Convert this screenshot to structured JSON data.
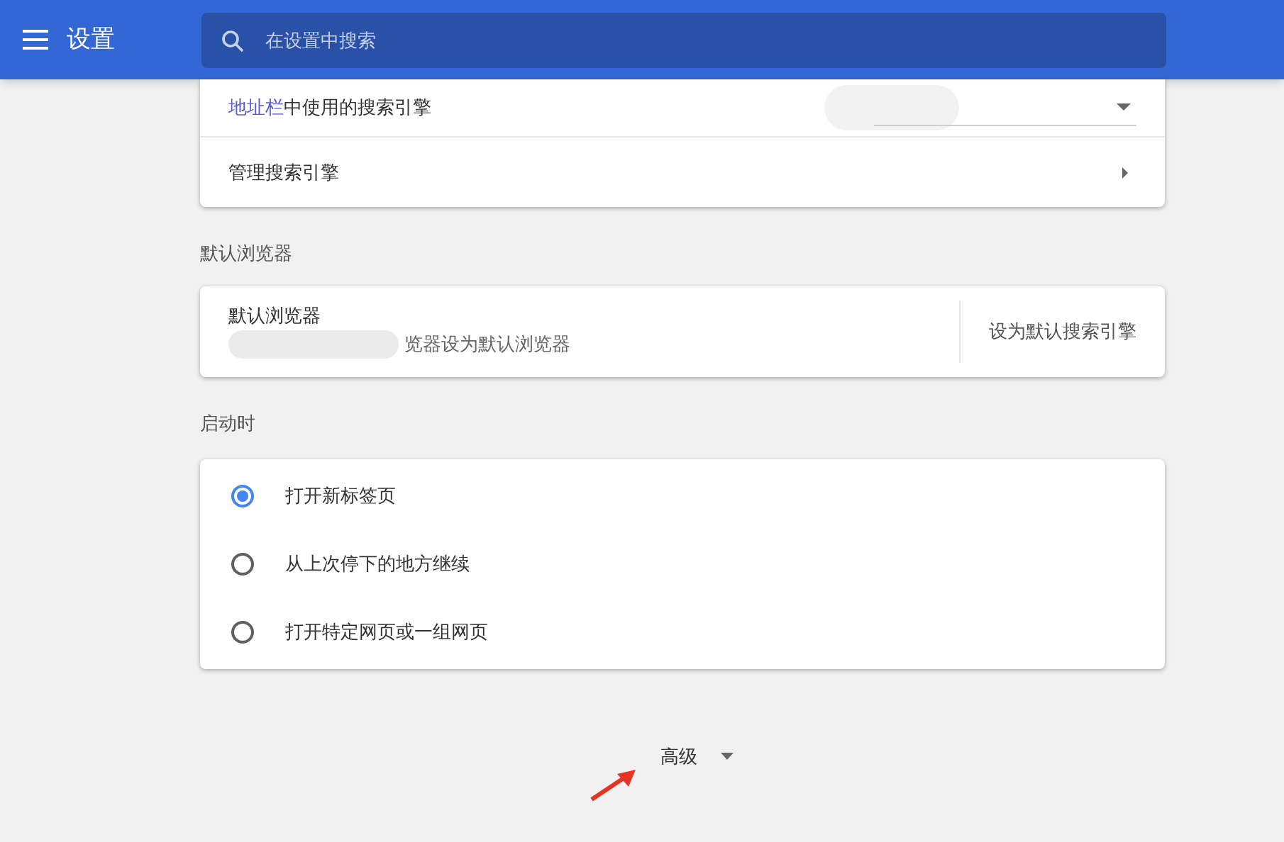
{
  "header": {
    "title": "设置",
    "search": {
      "placeholder": "在设置中搜索"
    }
  },
  "search_engine": {
    "address_bar_row": {
      "label_link": "地址栏",
      "label_rest": "中使用的搜索引擎"
    },
    "manage_row": {
      "label": "管理搜索引擎"
    }
  },
  "default_browser": {
    "heading": "默认浏览器",
    "title": "默认浏览器",
    "description": "览器设为默认浏览器",
    "button": "设为默认搜索引擎"
  },
  "on_startup": {
    "heading": "启动时",
    "options": [
      {
        "label": "打开新标签页",
        "selected": true
      },
      {
        "label": "从上次停下的地方继续",
        "selected": false
      },
      {
        "label": "打开特定网页或一组网页",
        "selected": false
      }
    ]
  },
  "advanced": {
    "label": "高级",
    "expanded": false
  }
}
